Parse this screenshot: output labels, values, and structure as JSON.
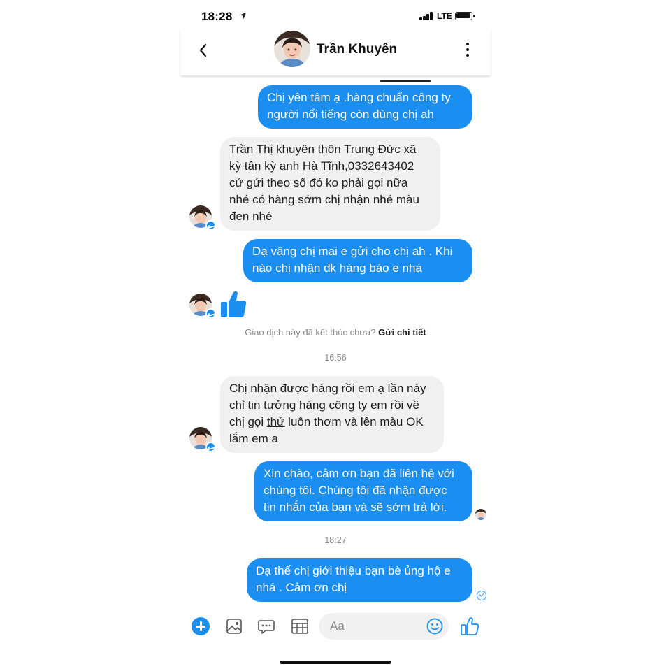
{
  "status_bar": {
    "time": "18:28",
    "network": "LTE"
  },
  "header": {
    "contact_name": "Trần Khuyên"
  },
  "messages": [
    {
      "direction": "out",
      "lines": [
        "Chị yên tâm ạ .hàng chuẩn công ty",
        "người nổi tiếng còn dùng chị ah"
      ]
    },
    {
      "direction": "in",
      "lines": [
        "Trần Thị khuyên thôn Trung Đức xã",
        "kỳ tân kỳ anh Hà Tĩnh,0332643402",
        "cứ gửi theo số đó ko phải gọi nữa",
        "nhé có hàng sớm chị nhận nhé màu",
        "đen nhé"
      ]
    },
    {
      "direction": "out",
      "lines": [
        "Dạ vâng chị mai e gửi cho chị ah . Khi",
        "nào chị nhận dk hàng báo e nhá"
      ]
    },
    {
      "direction": "in",
      "sticker": "thumbs-up"
    },
    {
      "direction": "in",
      "lines": [
        "Chị nhận được hàng rồi em ạ lần này",
        "chỉ tin tưởng hàng công ty em rồi về"
      ],
      "line3_before": "chị gọi ",
      "line3_underlined": "thử",
      "line3_after": " luôn thơm và lên màu OK",
      "line4": "lắm em a"
    },
    {
      "direction": "out",
      "lines": [
        "Xin chào, cảm ơn bạn đã liên hệ với",
        "chúng tôi. Chúng tôi đã nhận được",
        "tin nhắn của bạn và sẽ sớm trả lời."
      ]
    },
    {
      "direction": "out",
      "lines": [
        "Dạ thế chị giới thiệu bạn bè ủng hộ e",
        "nhá  . Cảm ơn chị"
      ]
    }
  ],
  "system_prompt": {
    "question": "Giao dịch này đã kết thúc chưa? ",
    "link": "Gửi chi tiết"
  },
  "timestamps": [
    "16:56",
    "18:27"
  ],
  "composer": {
    "placeholder": "Aa"
  },
  "colors": {
    "accent": "#1b8ef2",
    "incoming_bubble": "#f0f0f0"
  },
  "icons": [
    "location-arrow-icon",
    "signal-icon",
    "battery-icon",
    "back-chevron-icon",
    "more-vertical-icon",
    "messenger-badge-icon",
    "thumbs-up-icon",
    "seen-icon",
    "plus-icon",
    "image-icon",
    "chat-bubble-icon",
    "gif-icon",
    "emoji-icon",
    "like-icon"
  ]
}
